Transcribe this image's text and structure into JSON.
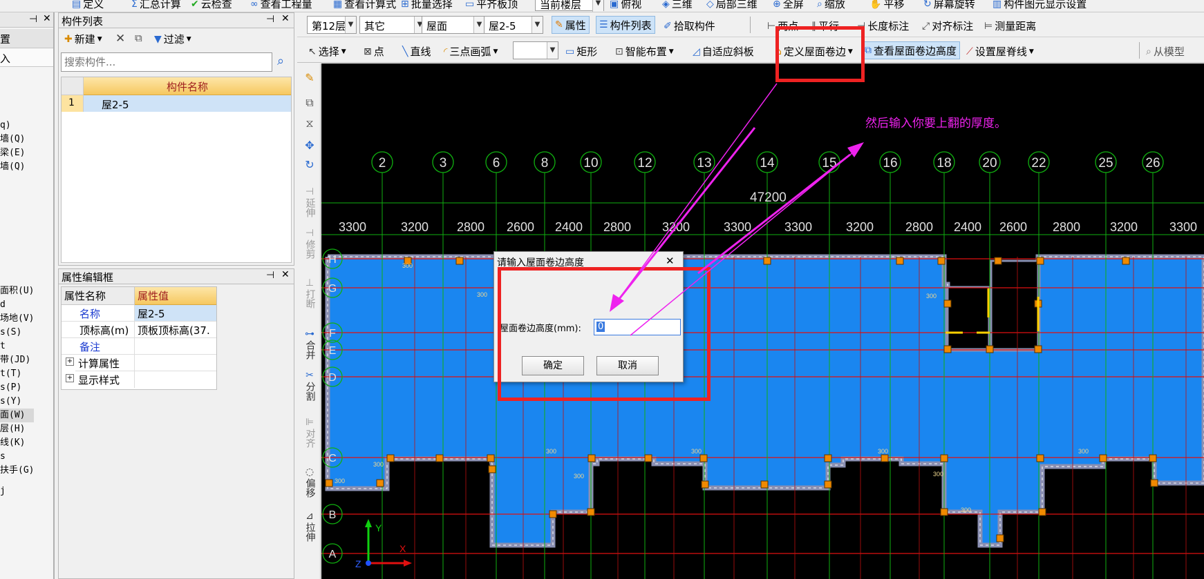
{
  "toolbar_top": {
    "items": [
      "定义",
      "汇总计算",
      "云检查",
      "查看工程量",
      "查看计算式",
      "批量选择",
      "平齐板顶",
      "当前楼层",
      "俯视",
      "三维",
      "局部三维",
      "全屏",
      "缩放",
      "平移",
      "屏幕旋转",
      "构件图元显示设置"
    ]
  },
  "toolbar_row1": {
    "floor": "第12层",
    "category": "其它",
    "type": "屋面",
    "member": "屋2-5",
    "btn_properties": "属性",
    "btn_member_list": "构件列表",
    "btn_pick": "拾取构件",
    "btn_two_points": "两点",
    "btn_parallel": "平行",
    "btn_length_dim": "长度标注",
    "btn_align_dim": "对齐标注",
    "btn_measure": "测量距离"
  },
  "toolbar_row2": {
    "select": "选择",
    "point": "点",
    "line": "直线",
    "arc3": "三点画弧",
    "rect": "矩形",
    "smart": "智能布置",
    "adaptive_slope": "自适应斜板",
    "define_roof_edge": "定义屋面卷边",
    "view_roof_edge": "查看屋面卷边高度",
    "set_ridge": "设置屋脊线",
    "from_model": "从模型"
  },
  "left_panel": {
    "header_a": "置",
    "header_b": "入",
    "items": [
      "q)",
      "墙(Q)",
      "梁(E)",
      "墙(Q)",
      "面积(U)",
      "d",
      "场地(V)",
      "s(S)",
      "t",
      "带(JD)",
      "t(T)",
      "s(P)",
      "s(Y)",
      "面(W)",
      "层(H)",
      "线(K)",
      "s",
      "扶手(G)",
      "j"
    ]
  },
  "member_list": {
    "title": "构件列表",
    "new_label": "新建",
    "filter_label": "过滤",
    "search_placeholder": "搜索构件...",
    "col_header": "构件名称",
    "rows": [
      {
        "num": "1",
        "name": "屋2-5"
      }
    ]
  },
  "property_panel": {
    "title": "属性编辑框",
    "col_name": "属性名称",
    "col_value": "属性值",
    "rows": [
      {
        "name": "名称",
        "value": "屋2-5"
      },
      {
        "name": "顶标高(m)",
        "value": "顶板顶标高(37."
      },
      {
        "name": "备注",
        "value": ""
      },
      {
        "name": "计算属性",
        "value": ""
      },
      {
        "name": "显示样式",
        "value": ""
      }
    ]
  },
  "side_tools": [
    "延伸",
    "修剪",
    "打断",
    "合并",
    "分割",
    "对齐",
    "偏移",
    "拉伸"
  ],
  "canvas": {
    "column_labels": [
      "2",
      "3",
      "6",
      "8",
      "10",
      "12",
      "13",
      "14",
      "15",
      "16",
      "18",
      "20",
      "22",
      "25",
      "26"
    ],
    "row_labels": [
      "H",
      "G",
      "F",
      "E",
      "D",
      "C",
      "B",
      "A"
    ],
    "total_dim": "47200",
    "dims": [
      "3300",
      "3200",
      "2800",
      "2600",
      "2400",
      "2800",
      "3200",
      "3300",
      "3300",
      "3200",
      "2800",
      "2400",
      "2600",
      "2800",
      "3200",
      "3300"
    ],
    "annotation": "然后输入你要上翻的厚度。",
    "small_label": "300"
  },
  "dialog": {
    "title": "请输入屋面卷边高度",
    "field_label": "屋面卷边高度(mm):",
    "field_value": "0",
    "ok": "确定",
    "cancel": "取消"
  },
  "colors": {
    "roof": "#1a86f0",
    "wall": "#8a8fb2",
    "grid_red": "#e01010",
    "grid_green": "#10b010",
    "annot": "#ee22ee",
    "highlight_box": "#ee2222"
  }
}
